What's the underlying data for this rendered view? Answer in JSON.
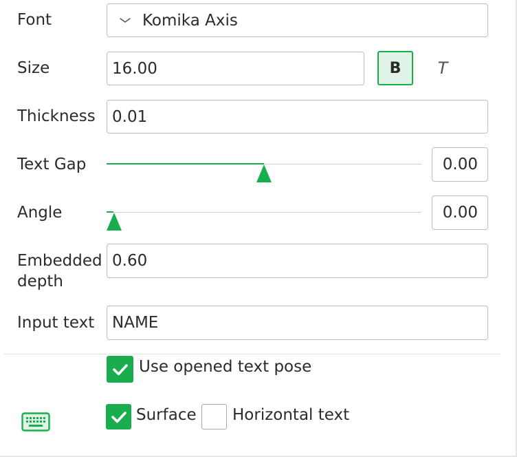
{
  "font": {
    "label": "Font",
    "value": "Komika Axis"
  },
  "size": {
    "label": "Size",
    "value": "16.00",
    "bold_label": "B",
    "italic_label": "T"
  },
  "thickness": {
    "label": "Thickness",
    "value": "0.01"
  },
  "text_gap": {
    "label": "Text Gap",
    "value": "0.00",
    "slider_fraction": 0.5
  },
  "angle": {
    "label": "Angle",
    "value": "0.00",
    "slider_fraction": 0.0
  },
  "embedded_depth": {
    "label_line1": "Embedded",
    "label_line2": "depth",
    "value": "0.60"
  },
  "input_text": {
    "label": "Input text",
    "value": "NAME"
  },
  "options": {
    "use_opened_text_pose": {
      "label": "Use opened text pose",
      "checked": true
    },
    "surface": {
      "label": "Surface",
      "checked": true
    },
    "horizontal_text": {
      "label": "Horizontal text",
      "checked": false
    }
  },
  "colors": {
    "accent": "#1aad4e",
    "accent_light": "#dff3e6",
    "border": "#bdbdbd"
  },
  "icons": {
    "font_dropdown": "chevron-down-icon",
    "keyboard": "keyboard-icon"
  }
}
